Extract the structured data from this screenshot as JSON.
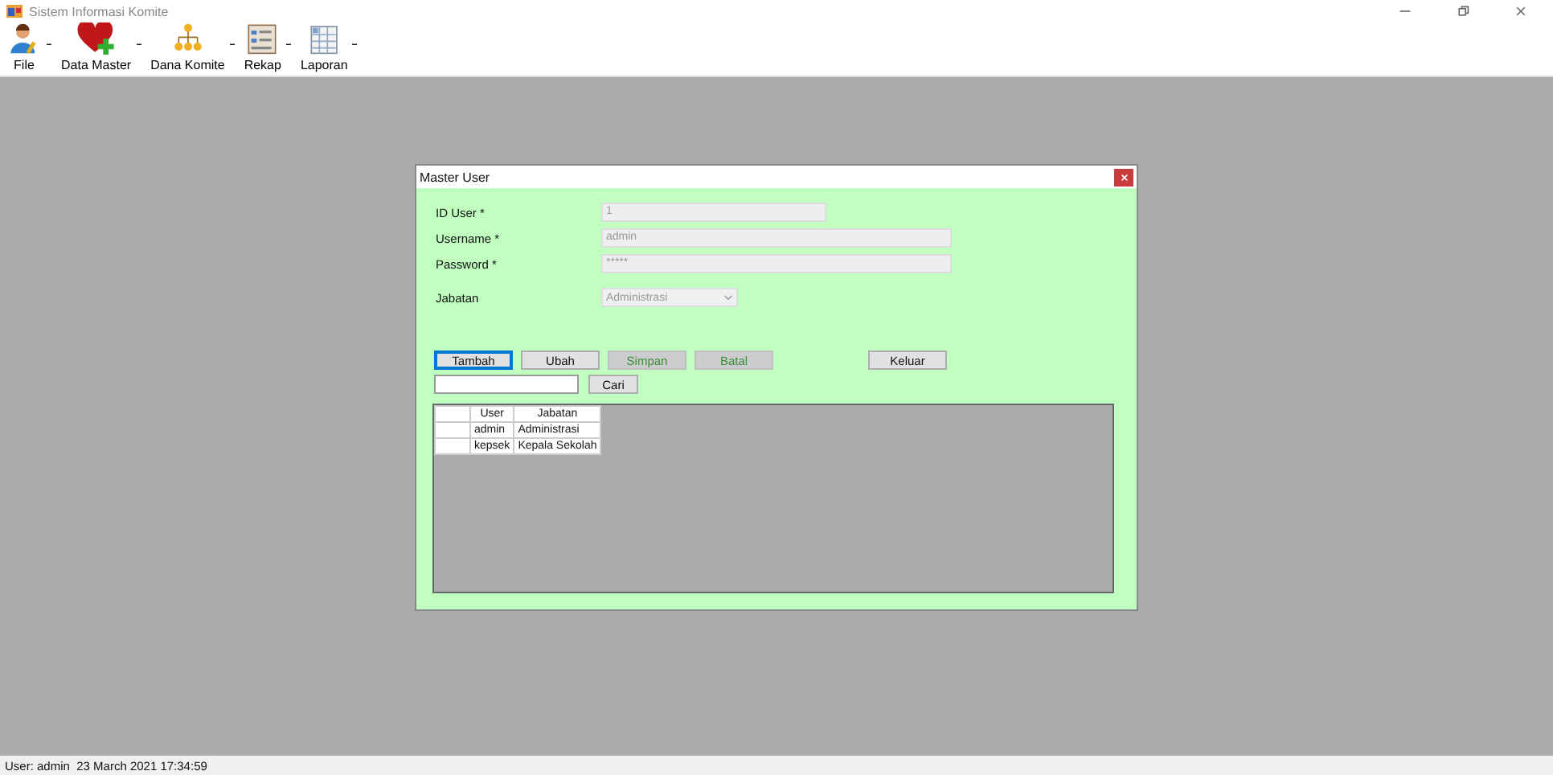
{
  "window": {
    "title": "Sistem Informasi Komite"
  },
  "toolbar": [
    {
      "label": "File",
      "kind": "user"
    },
    {
      "label": "Data Master",
      "kind": "heart"
    },
    {
      "label": "Dana Komite",
      "kind": "org"
    },
    {
      "label": "Rekap",
      "kind": "report"
    },
    {
      "label": "Laporan",
      "kind": "table"
    }
  ],
  "dialog": {
    "title": "Master User",
    "fields": [
      {
        "label": "ID User *",
        "value": "1",
        "kind": "short"
      },
      {
        "label": "Username *",
        "value": "admin",
        "kind": "long"
      },
      {
        "label": "Password *",
        "value": "*****",
        "kind": "long"
      },
      {
        "label": "Jabatan",
        "value": "Administrasi",
        "kind": "combo"
      }
    ],
    "buttons": [
      {
        "label": "Tambah",
        "disabled": false,
        "selected": true
      },
      {
        "label": "Ubah",
        "disabled": false,
        "selected": false
      },
      {
        "label": "Simpan",
        "disabled": true,
        "selected": false
      },
      {
        "label": "Batal",
        "disabled": true,
        "selected": false
      },
      {
        "label": "Keluar",
        "disabled": false,
        "selected": false
      }
    ],
    "search": {
      "button": "Cari"
    },
    "table": {
      "columns": [
        "User",
        "Jabatan"
      ],
      "rows": [
        [
          "admin",
          "Administrasi"
        ],
        [
          "kepsek",
          "Kepala Sekolah"
        ]
      ]
    }
  },
  "status_bar": "User: admin  23 March 2021 17:34:59"
}
